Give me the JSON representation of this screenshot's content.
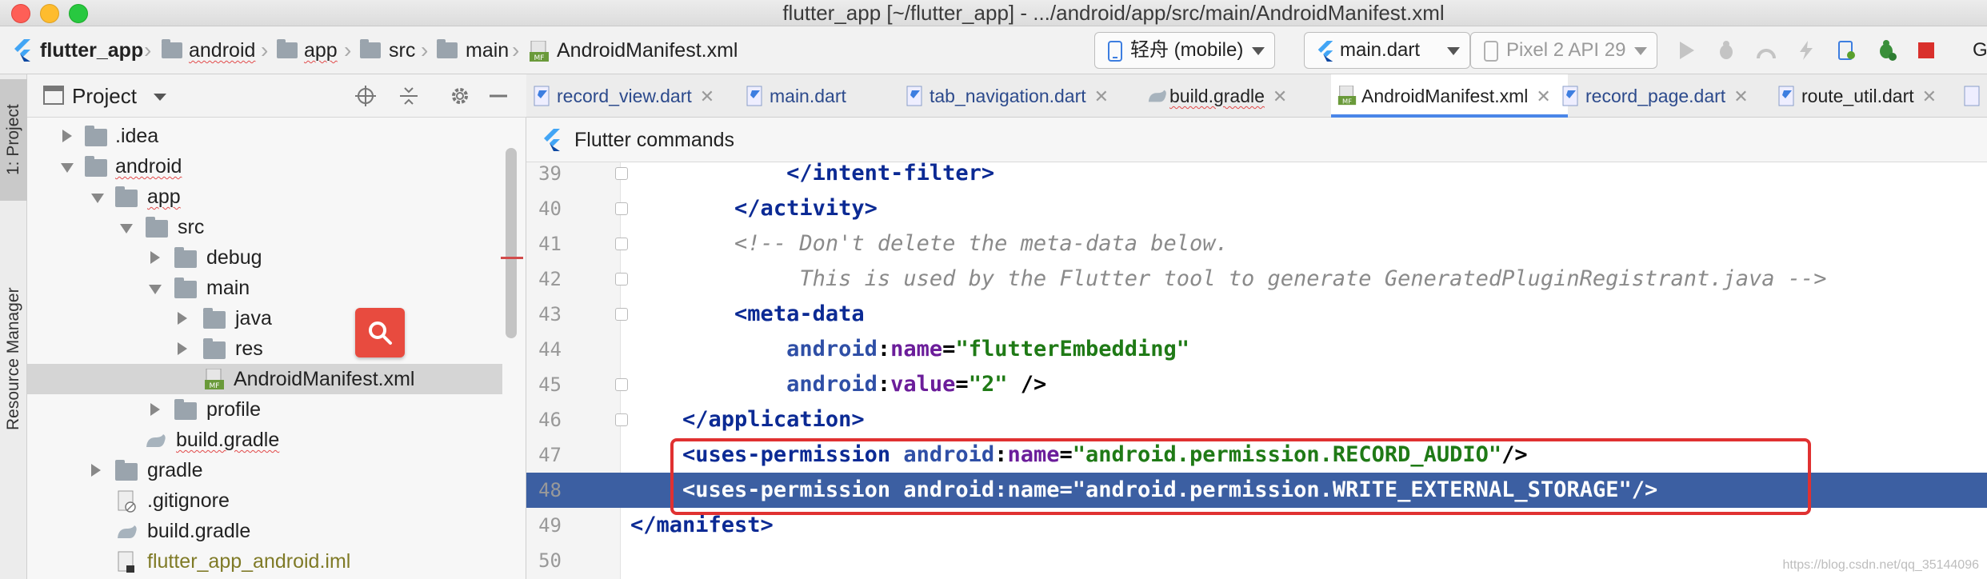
{
  "window": {
    "title": "flutter_app [~/flutter_app] - .../android/app/src/main/AndroidManifest.xml"
  },
  "breadcrumb": {
    "items": [
      "flutter_app",
      "android",
      "app",
      "src",
      "main",
      "AndroidManifest.xml"
    ]
  },
  "toolbar": {
    "device": "轻舟 (mobile)",
    "config": "main.dart",
    "emulator": "Pixel 2 API 29",
    "overflow": "G"
  },
  "side_tabs": {
    "project": "1: Project",
    "resource_manager": "Resource Manager"
  },
  "project_panel": {
    "title": "Project",
    "tree": [
      {
        "label": "▸ .idea",
        "name": ".idea"
      },
      {
        "name": "android"
      },
      {
        "name": "app"
      },
      {
        "name": "src"
      },
      {
        "name": "debug"
      },
      {
        "name": "main"
      },
      {
        "name": "java"
      },
      {
        "name": "res"
      },
      {
        "name": "AndroidManifest.xml"
      },
      {
        "name": "profile"
      },
      {
        "name": "build.gradle"
      },
      {
        "name": "gradle"
      },
      {
        "name": ".gitignore"
      },
      {
        "name": "build.gradle"
      },
      {
        "name": "flutter_app_android.iml"
      }
    ]
  },
  "tabs": [
    {
      "label": "record_view.dart"
    },
    {
      "label": "main.dart"
    },
    {
      "label": "tab_navigation.dart"
    },
    {
      "label": "build.gradle"
    },
    {
      "label": "AndroidManifest.xml"
    },
    {
      "label": "record_page.dart"
    },
    {
      "label": "route_util.dart"
    }
  ],
  "commands_bar": {
    "label": "Flutter commands"
  },
  "editor": {
    "lines": [
      {
        "n": "39",
        "indent": "            ",
        "parts": [
          [
            "tag",
            "</intent-filter>"
          ]
        ]
      },
      {
        "n": "40",
        "indent": "        ",
        "parts": [
          [
            "tag",
            "</activity>"
          ]
        ]
      },
      {
        "n": "41",
        "indent": "        ",
        "parts": [
          [
            "comment",
            "<!-- Don't delete the meta-data below."
          ]
        ]
      },
      {
        "n": "42",
        "indent": "             ",
        "parts": [
          [
            "comment",
            "This is used by the Flutter tool to generate GeneratedPluginRegistrant.java -->"
          ]
        ]
      },
      {
        "n": "43",
        "indent": "        ",
        "parts": [
          [
            "tag",
            "<meta-data"
          ]
        ]
      },
      {
        "n": "44",
        "indent": "            ",
        "parts": [
          [
            "ns",
            "android"
          ],
          [
            "plain",
            ":"
          ],
          [
            "attr",
            "name"
          ],
          [
            "plain",
            "="
          ],
          [
            "val",
            "\"flutterEmbedding\""
          ]
        ]
      },
      {
        "n": "45",
        "indent": "            ",
        "parts": [
          [
            "ns",
            "android"
          ],
          [
            "plain",
            ":"
          ],
          [
            "attr",
            "value"
          ],
          [
            "plain",
            "="
          ],
          [
            "val",
            "\"2\""
          ],
          [
            "plain",
            " />"
          ]
        ]
      },
      {
        "n": "46",
        "indent": "    ",
        "parts": [
          [
            "tag",
            "</application>"
          ]
        ]
      },
      {
        "n": "47",
        "indent": "    ",
        "parts": [
          [
            "tag",
            "<uses-permission "
          ],
          [
            "ns",
            "android"
          ],
          [
            "plain",
            ":"
          ],
          [
            "attr",
            "name"
          ],
          [
            "plain",
            "="
          ],
          [
            "val",
            "\"android.permission.RECORD_AUDIO\""
          ],
          [
            "plain",
            "/>"
          ]
        ]
      },
      {
        "n": "48",
        "indent": "    ",
        "parts": [
          [
            "tag",
            "<uses-permission "
          ],
          [
            "ns",
            "android"
          ],
          [
            "plain",
            ":"
          ],
          [
            "attr",
            "name"
          ],
          [
            "plain",
            "="
          ],
          [
            "val",
            "\"android.permission.WRITE_EXTERNAL_STORAGE\""
          ],
          [
            "plain",
            "/>"
          ]
        ]
      },
      {
        "n": "49",
        "indent": "",
        "parts": [
          [
            "tag",
            "</manifest>"
          ]
        ]
      },
      {
        "n": "50",
        "indent": "",
        "parts": []
      }
    ]
  },
  "watermark": "https://blog.csdn.net/qq_35144096",
  "colors": {
    "selection": "#3c5fa2",
    "highlight_box": "#e03131",
    "active_tab_underline": "#4a86e8"
  }
}
